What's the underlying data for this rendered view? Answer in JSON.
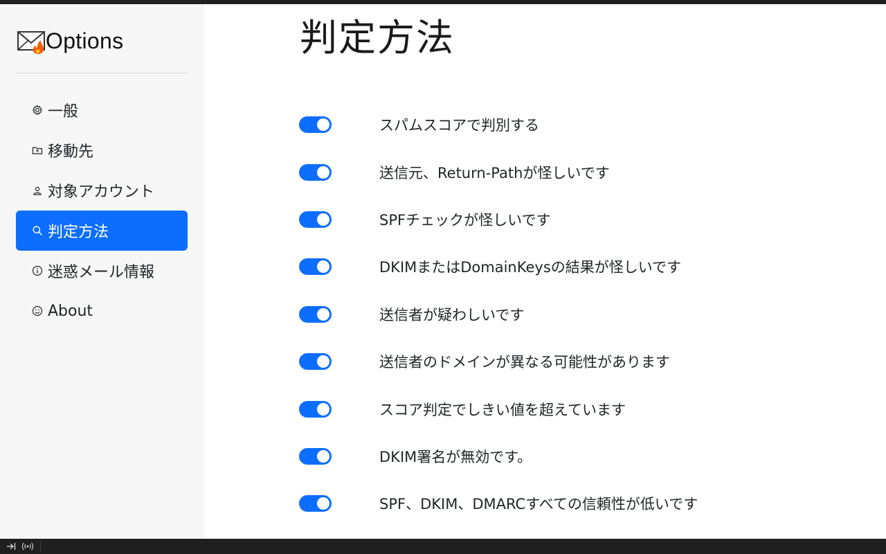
{
  "brand": {
    "title": "Options"
  },
  "sidebar": {
    "items": [
      {
        "label": "一般",
        "icon": "gear-icon",
        "active": false
      },
      {
        "label": "移動先",
        "icon": "folder-icon",
        "active": false
      },
      {
        "label": "対象アカウント",
        "icon": "person-icon",
        "active": false
      },
      {
        "label": "判定方法",
        "icon": "search-icon",
        "active": true
      },
      {
        "label": "迷惑メール情報",
        "icon": "info-icon",
        "active": false
      },
      {
        "label": "About",
        "icon": "smiley-icon",
        "active": false
      }
    ]
  },
  "page": {
    "title": "判定方法"
  },
  "rules": [
    {
      "label": "スパムスコアで判別する",
      "enabled": true
    },
    {
      "label": "送信元、Return-Pathが怪しいです",
      "enabled": true
    },
    {
      "label": "SPFチェックが怪しいです",
      "enabled": true
    },
    {
      "label": "DKIMまたはDomainKeysの結果が怪しいです",
      "enabled": true
    },
    {
      "label": "送信者が疑わしいです",
      "enabled": true
    },
    {
      "label": "送信者のドメインが異なる可能性があります",
      "enabled": true
    },
    {
      "label": "スコア判定でしきい値を超えています",
      "enabled": true
    },
    {
      "label": "DKIM署名が無効です。",
      "enabled": true
    },
    {
      "label": "SPF、DKIM、DMARCすべての信頼性が低いです",
      "enabled": true
    },
    {
      "label": "",
      "enabled": true
    }
  ],
  "colors": {
    "accent": "#0d6efd",
    "sidebar_bg": "#f7f7f8"
  }
}
